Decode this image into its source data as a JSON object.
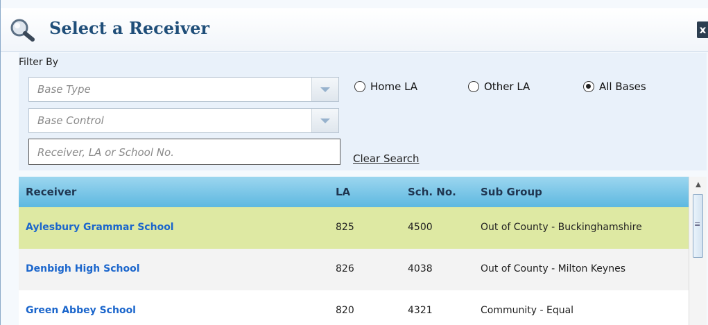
{
  "dialog": {
    "title": "Select a Receiver",
    "close_label": "x"
  },
  "filter": {
    "label": "Filter By",
    "base_type_placeholder": "Base Type",
    "base_control_placeholder": "Base Control",
    "search_placeholder": "Receiver, LA or School No.",
    "clear_search_label": "Clear Search",
    "radios": [
      {
        "label": "Home LA",
        "checked": false
      },
      {
        "label": "Other LA",
        "checked": false
      },
      {
        "label": "All Bases",
        "checked": true
      }
    ]
  },
  "grid": {
    "columns": [
      "Receiver",
      "LA",
      "Sch. No.",
      "Sub Group"
    ],
    "rows": [
      {
        "receiver": "Aylesbury Grammar School",
        "la": "825",
        "sch_no": "4500",
        "sub_group": "Out of County - Buckinghamshire",
        "selected": true
      },
      {
        "receiver": "Denbigh High School",
        "la": "826",
        "sch_no": "4038",
        "sub_group": "Out of County - Milton Keynes",
        "selected": false
      },
      {
        "receiver": "Green Abbey School",
        "la": "820",
        "sch_no": "4321",
        "sub_group": "Community - Equal",
        "selected": false
      }
    ]
  },
  "icons": {
    "title": "magnifier-icon",
    "close": "close-icon",
    "dropdown": "chevron-down-icon"
  }
}
